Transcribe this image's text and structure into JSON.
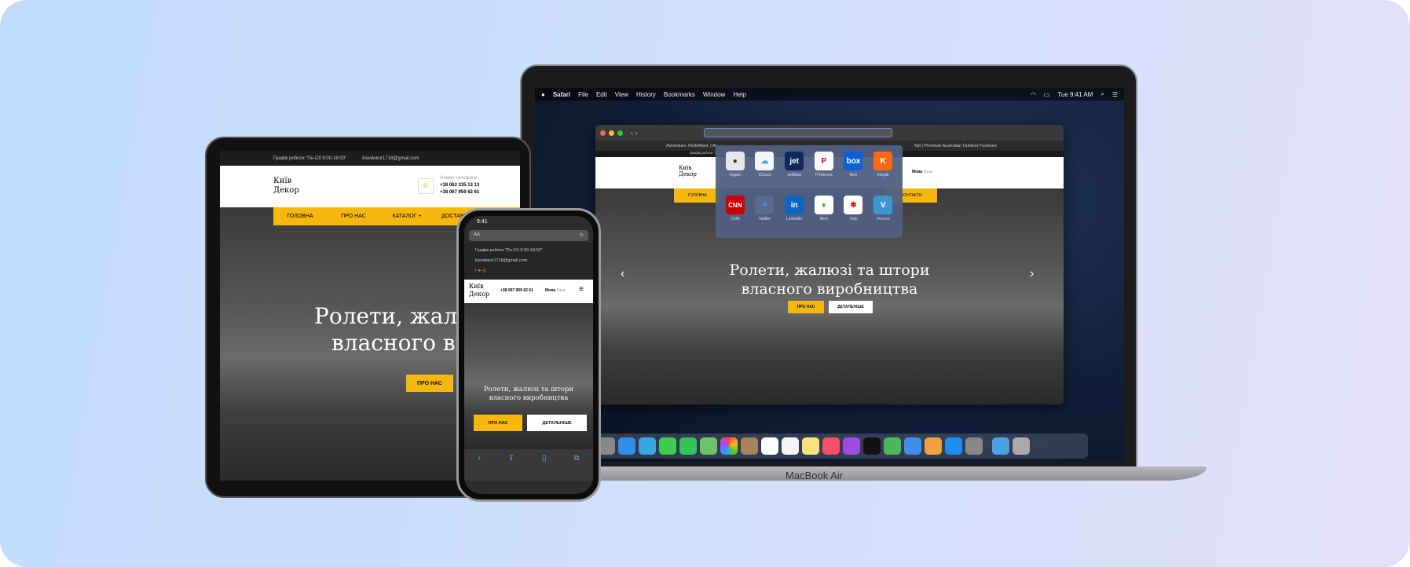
{
  "site": {
    "schedule": "Графік роботи \"Пн-Сб 9:00-18:00\"",
    "email": "kievdekor1718@gmail.com",
    "logo_line1": "Київ",
    "logo_line2": "Декор",
    "phone_label": "Номер телефону",
    "phones": [
      "+38 063 335 13 13",
      "+38 067 959 62 61"
    ],
    "nav": [
      "ГОЛОВНА",
      "ПРО НАС",
      "КАТАЛОГ +",
      "ДОСТАВКА ТА"
    ],
    "nav_contacts": "КОНТАКТИ",
    "hero_title_line1": "Ролети, жалюзі та штори",
    "hero_title_line2": "власного виробництва",
    "tablet_title_line1": "Ролети, жал",
    "tablet_title_line2": "власного ви",
    "btn_about": "ПРО НАС",
    "btn_details": "ДЕТАЛЬНІШЕ",
    "lang_active": "Мова",
    "lang_other": "Язык",
    "accent": "#f5b80f"
  },
  "mac": {
    "menu": [
      "Safari",
      "File",
      "Edit",
      "View",
      "History",
      "Bookmarks",
      "Window",
      "Help"
    ],
    "clock": "Tue 9:41 AM",
    "tabs": [
      "Adventure. Redefined. | Ac",
      "Tait | Premium Australian Outdoor Furniture"
    ],
    "favorites": [
      {
        "label": "Apple",
        "color": "#e8e8e8"
      },
      {
        "label": "iCloud",
        "color": "#f2f6fb"
      },
      {
        "label": "JetBlue",
        "color": "#0c2a5b"
      },
      {
        "label": "Pinterest",
        "color": "#ffffff"
      },
      {
        "label": "Box",
        "color": "#0a62d6"
      },
      {
        "label": "Kayak",
        "color": "#ff690f"
      },
      {
        "label": "CNN",
        "color": "#cc0000"
      },
      {
        "label": "Twitter",
        "color": "#5a6a90"
      },
      {
        "label": "LinkedIn",
        "color": "#0a66c2"
      },
      {
        "label": "Mint",
        "color": "#ffffff"
      },
      {
        "label": "Yelp",
        "color": "#ffffff"
      },
      {
        "label": "Venmo",
        "color": "#3d95ce"
      }
    ],
    "model": "MacBook Air"
  },
  "phone": {
    "time": "9:41",
    "address": "AA"
  }
}
